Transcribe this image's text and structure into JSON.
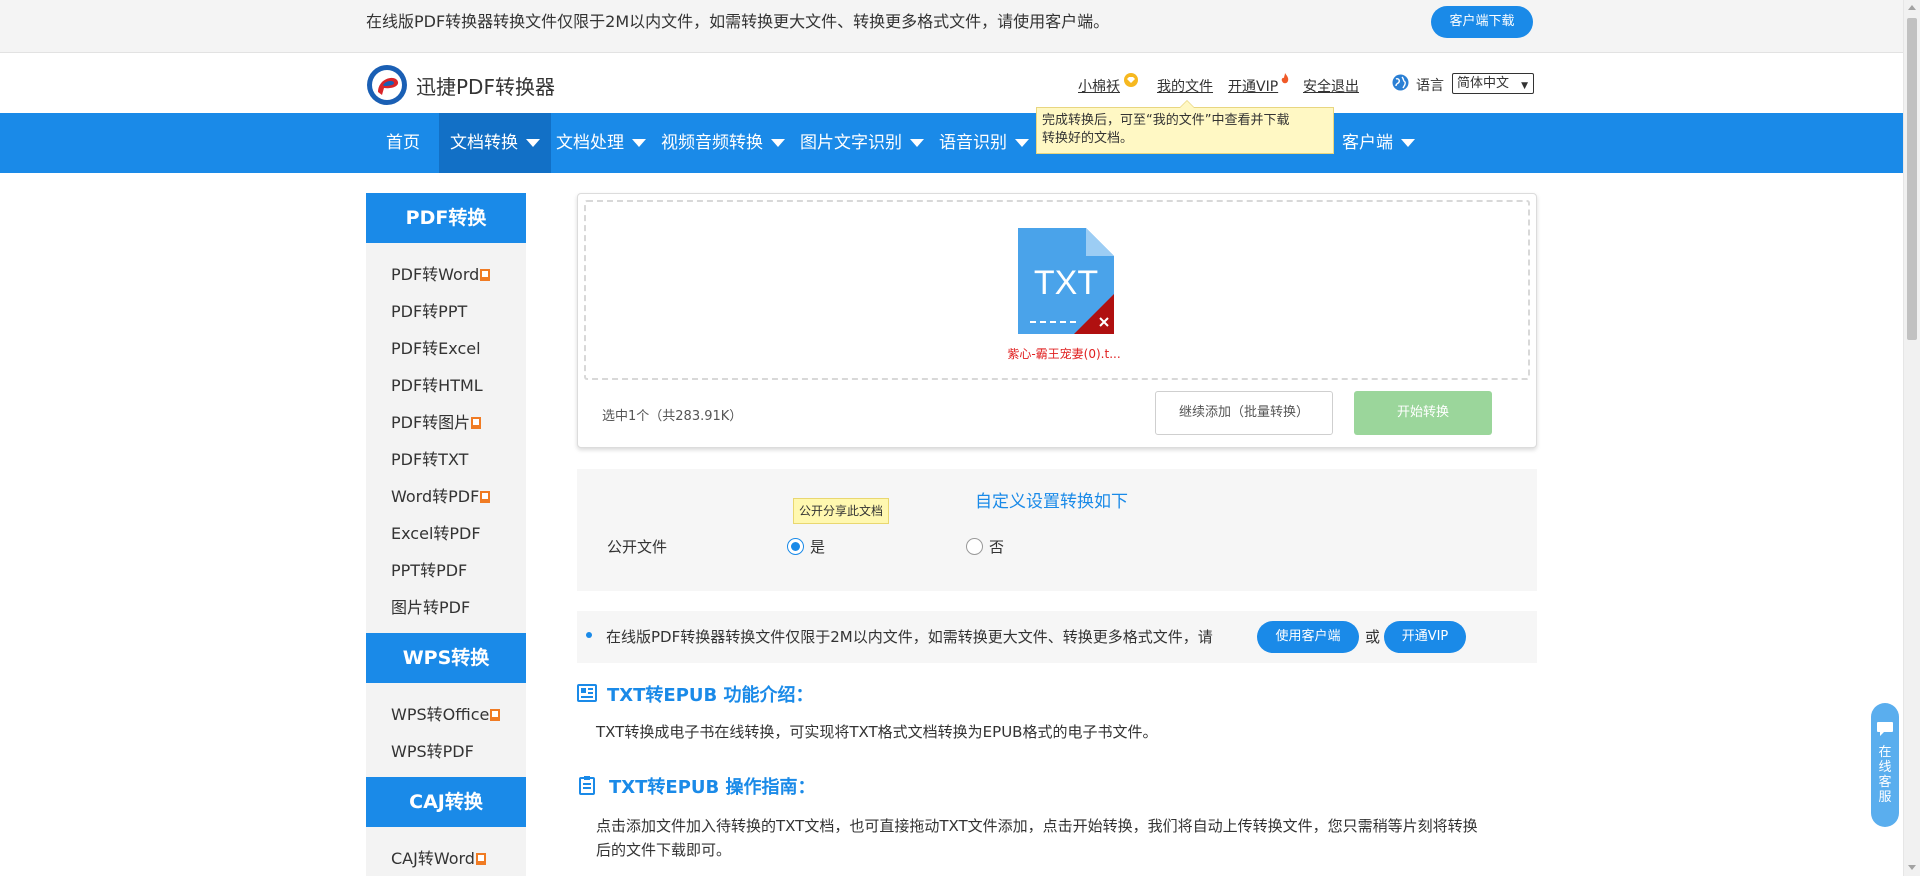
{
  "notice": {
    "text": "在线版PDF转换器转换文件仅限于2M以内文件，如需转换更大文件、转换更多格式文件，请使用客户端。",
    "client_download": "客户端下载"
  },
  "header": {
    "logo_text": "迅捷PDF转换器",
    "user_name": "小棉袄",
    "my_files": "我的文件",
    "open_vip": "开通VIP",
    "logout": "安全退出",
    "lang_label": "语言",
    "lang_value": "简体中文"
  },
  "nav": {
    "items": [
      {
        "label": "首页"
      },
      {
        "label": "文档转换"
      },
      {
        "label": "文档处理"
      },
      {
        "label": "视频音频转换"
      },
      {
        "label": "图片文字识别"
      },
      {
        "label": "语音识别"
      },
      {
        "label": "客户端"
      }
    ]
  },
  "tooltip": {
    "line1": "完成转换后，可至“我的文件”中查看并下载",
    "line2": "转换好的文档。"
  },
  "sidebar": {
    "groups": [
      {
        "title": "PDF转换",
        "items": [
          "PDF转Word",
          "PDF转PPT",
          "PDF转Excel",
          "PDF转HTML",
          "PDF转图片",
          "PDF转TXT",
          "Word转PDF",
          "Excel转PDF",
          "PPT转PDF",
          "图片转PDF"
        ]
      },
      {
        "title": "WPS转换",
        "items": [
          "WPS转Office",
          "WPS转PDF"
        ]
      },
      {
        "title": "CAJ转换",
        "items": [
          "CAJ转Word"
        ]
      }
    ]
  },
  "upload": {
    "file_type": "TXT",
    "file_name": "紫心-霸王宠妻(0).t...",
    "selected_info": "选中1个（共283.91K）",
    "add_more": "继续添加（批量转换）",
    "start": "开始转换"
  },
  "settings": {
    "title": "自定义设置转换如下",
    "label": "公开文件",
    "share_tip": "公开分享此文档",
    "option_yes": "是",
    "option_no": "否",
    "selected": "是"
  },
  "info": {
    "text": "在线版PDF转换器转换文件仅限于2M以内文件，如需转换更大文件、转换更多格式文件，请",
    "use_client": "使用客户端",
    "or": "或",
    "open_vip": "开通VIP"
  },
  "sections": {
    "intro_title": "TXT转EPUB 功能介绍：",
    "intro_body": "TXT转换成电子书在线转换，可实现将TXT格式文档转换为EPUB格式的电子书文件。",
    "guide_title": "TXT转EPUB 操作指南：",
    "guide_body_1": "点击添加文件加入待转换的TXT文档，也可直接拖动TXT文件添加，点击开始转换，我们将自动上传转换文件，您只需稍等片刻将转换",
    "guide_body_2": "后的文件下载即可。"
  },
  "float_service": {
    "label": "在线客服"
  },
  "colors": {
    "accent": "#1a8ae8",
    "start_button": "#9bd69b",
    "file_name": "#e02020",
    "vip_badge": "#f07b23"
  },
  "icons": [
    "diamond-icon",
    "flame-icon",
    "globe-icon",
    "txt-file-icon",
    "remove-file-icon",
    "intro-section-icon",
    "guide-section-icon",
    "chat-icon"
  ]
}
